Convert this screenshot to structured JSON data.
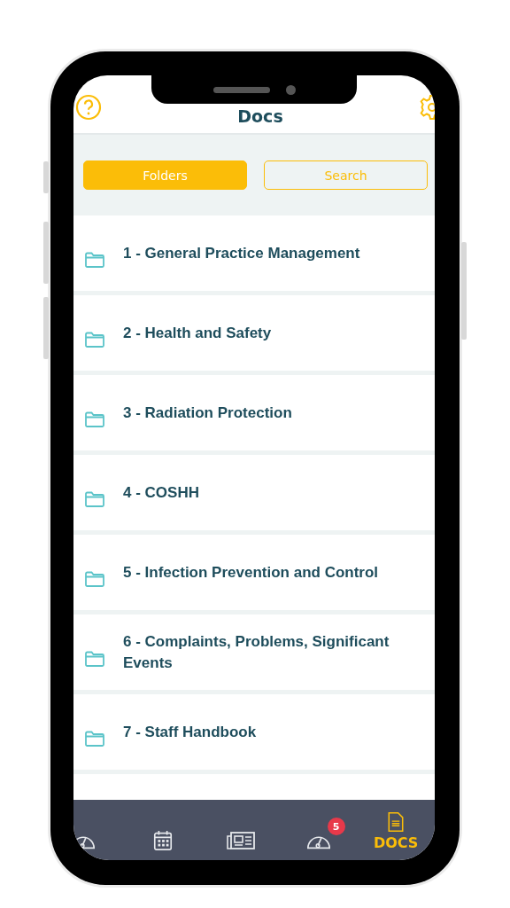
{
  "header": {
    "title": "Docs"
  },
  "tabs": [
    {
      "label": "Folders",
      "selected": true
    },
    {
      "label": "Search",
      "selected": false
    }
  ],
  "folders": [
    {
      "label": "1 - General Practice Management"
    },
    {
      "label": "2 - Health and Safety"
    },
    {
      "label": "3 - Radiation Protection"
    },
    {
      "label": "4 - COSHH"
    },
    {
      "label": "5 - Infection Prevention and Control"
    },
    {
      "label": "6 - Complaints, Problems, Significant Events"
    },
    {
      "label": "7 - Staff Handbook"
    }
  ],
  "nav": [
    {
      "kind": "gauge",
      "selected": false
    },
    {
      "kind": "calendar",
      "selected": false
    },
    {
      "kind": "news",
      "selected": false
    },
    {
      "kind": "gauge",
      "selected": false,
      "badge": "5"
    },
    {
      "kind": "doc",
      "selected": true,
      "label": "DOCS"
    }
  ]
}
